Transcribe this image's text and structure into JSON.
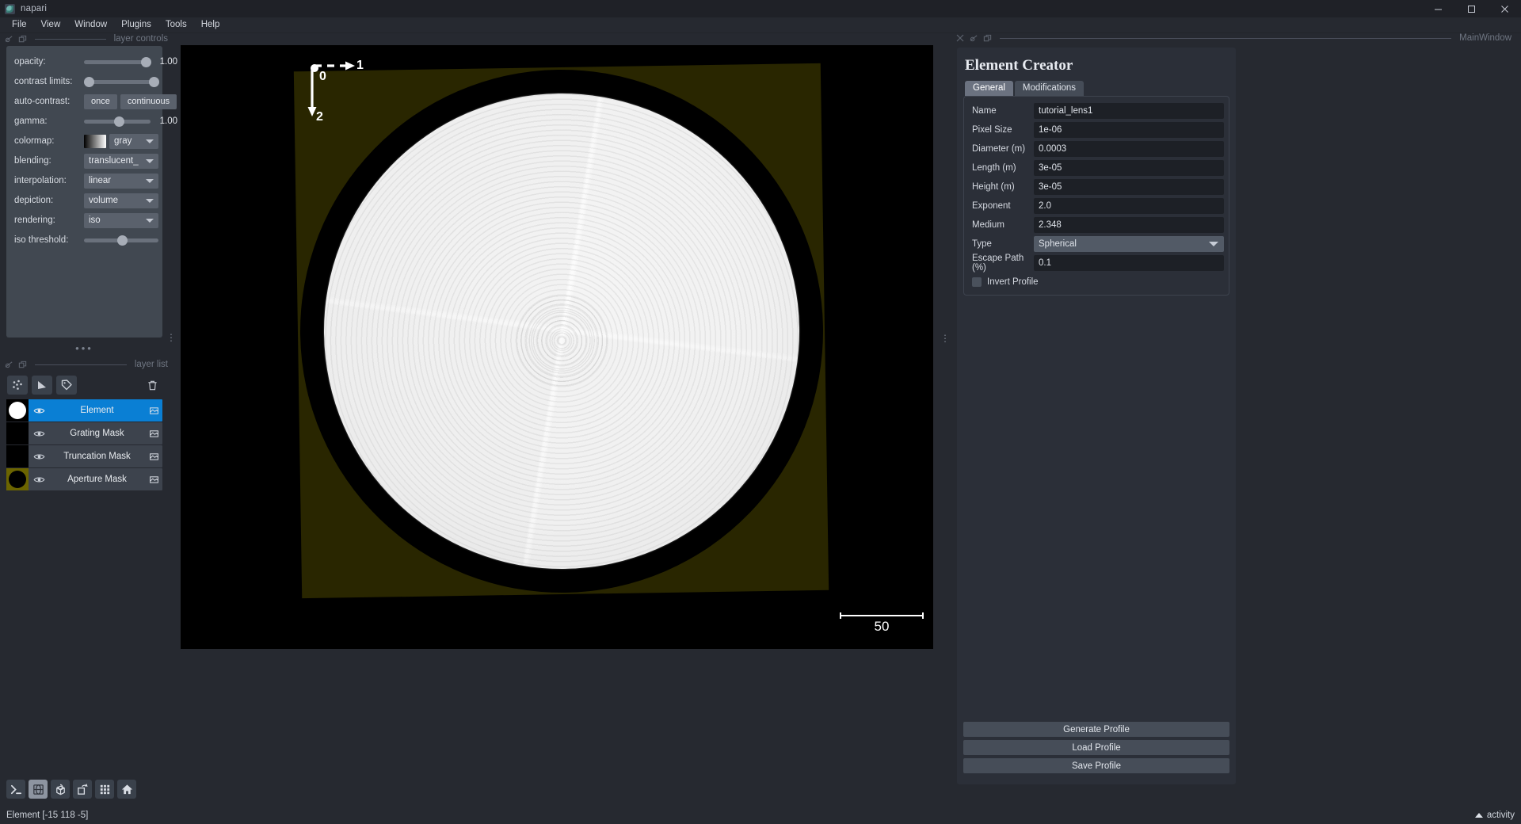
{
  "window": {
    "title": "napari",
    "icon": "napari-logo-icon",
    "controls": {
      "minimize": "─",
      "maximize": "□",
      "close": "✕"
    }
  },
  "menubar": {
    "items": [
      "File",
      "View",
      "Window",
      "Plugins",
      "Tools",
      "Help"
    ]
  },
  "left_dock": {
    "title": "layer controls",
    "controls": [
      {
        "label": "opacity:",
        "type": "slider",
        "value": "1.00",
        "fill": 88
      },
      {
        "label": "contrast limits:",
        "type": "range",
        "value": "",
        "fill": 2
      },
      {
        "label": "auto-contrast:",
        "type": "buttons",
        "buttons": [
          "once",
          "continuous"
        ]
      },
      {
        "label": "gamma:",
        "type": "slider",
        "value": "1.00",
        "fill": 47
      },
      {
        "label": "colormap:",
        "type": "swatch-combo",
        "value": "gray"
      },
      {
        "label": "blending:",
        "type": "combo",
        "value": "translucent_"
      },
      {
        "label": "interpolation:",
        "type": "combo",
        "value": "linear"
      },
      {
        "label": "depiction:",
        "type": "combo",
        "value": "volume"
      },
      {
        "label": "rendering:",
        "type": "combo",
        "value": "iso"
      },
      {
        "label": "iso threshold:",
        "type": "slider",
        "value": "",
        "fill": 48
      }
    ]
  },
  "layer_list": {
    "title": "layer list",
    "tools": [
      {
        "name": "new-points-layer-icon",
        "tooltip": "New points layer"
      },
      {
        "name": "new-shapes-layer-icon",
        "tooltip": "New shapes layer"
      },
      {
        "name": "new-labels-layer-icon",
        "tooltip": "New labels layer"
      },
      {
        "name": "delete-layer-icon",
        "tooltip": "Delete selected layers"
      }
    ],
    "layers": [
      {
        "name": "Element",
        "selected": true,
        "visible": true,
        "thumb": "white-disc"
      },
      {
        "name": "Grating Mask",
        "selected": false,
        "visible": true,
        "thumb": "black"
      },
      {
        "name": "Truncation Mask",
        "selected": false,
        "visible": true,
        "thumb": "black"
      },
      {
        "name": "Aperture Mask",
        "selected": false,
        "visible": true,
        "thumb": "olive-ring"
      }
    ]
  },
  "canvas": {
    "axes_labels": [
      "0",
      "1",
      "2"
    ],
    "scalebar": {
      "length_label": "50"
    }
  },
  "right_dock": {
    "dock_title": "MainWindow",
    "panel_title": "Element Creator",
    "tabs": [
      {
        "label": "General",
        "active": true
      },
      {
        "label": "Modifications",
        "active": false
      }
    ],
    "fields": [
      {
        "label": "Name",
        "value": "tutorial_lens1",
        "type": "text"
      },
      {
        "label": "Pixel Size",
        "value": "1e-06",
        "type": "text"
      },
      {
        "label": "Diameter (m)",
        "value": "0.0003",
        "type": "text"
      },
      {
        "label": "Length (m)",
        "value": "3e-05",
        "type": "text"
      },
      {
        "label": "Height (m)",
        "value": "3e-05",
        "type": "text"
      },
      {
        "label": "Exponent",
        "value": "2.0",
        "type": "text"
      },
      {
        "label": "Medium",
        "value": "2.348",
        "type": "text"
      },
      {
        "label": "Type",
        "value": "Spherical",
        "type": "select"
      },
      {
        "label": "Escape Path (%)",
        "value": "0.1",
        "type": "text"
      }
    ],
    "checkbox": {
      "label": "Invert Profile",
      "checked": false
    },
    "buttons": [
      "Generate Profile",
      "Load Profile",
      "Save Profile"
    ]
  },
  "bottom_toolbar": {
    "items": [
      {
        "name": "console-icon",
        "active": false
      },
      {
        "name": "ndisplay-toggle-icon",
        "active": true
      },
      {
        "name": "roll-dimensions-icon",
        "active": false
      },
      {
        "name": "transpose-dimensions-icon",
        "active": false
      },
      {
        "name": "grid-view-icon",
        "active": false
      },
      {
        "name": "home-reset-view-icon",
        "active": false
      }
    ]
  },
  "statusbar": {
    "text": "Element [-15 118  -5]",
    "activity_label": "activity"
  }
}
